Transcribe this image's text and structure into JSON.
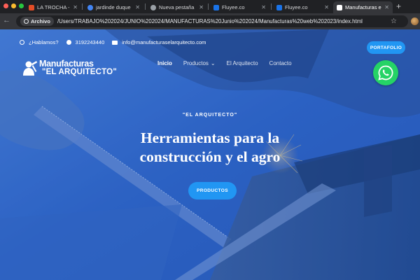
{
  "browser": {
    "tabs": [
      {
        "label": "LA TROCHA - La C",
        "favicon_color": "#e44d26",
        "active": false
      },
      {
        "label": "jardinde duque - Bu",
        "favicon_color": "#4285f4",
        "active": false
      },
      {
        "label": "Nueva pestaña",
        "favicon_color": "#9aa0a6",
        "active": false
      },
      {
        "label": "Fluyee.co",
        "favicon_color": "#1a73e8",
        "active": false
      },
      {
        "label": "Fluyee.co",
        "favicon_color": "#1a73e8",
        "active": false
      },
      {
        "label": "Manufacturas el ar",
        "favicon_color": "#ffffff",
        "active": true
      }
    ],
    "new_tab_label": "+",
    "back_label": "←",
    "forward_label": "→",
    "chip_label": "Archivo",
    "url": "/Users/TRABAJO%202024/JUNIO%202024/MANUFACTURAS%20Junio%202024/Manufacturas%20web%202023/index.html",
    "star_label": "☆"
  },
  "header": {
    "question_label": "¿Hablamos?",
    "phone": "3192243440",
    "email": "info@manufacturaselarquitecto.com",
    "logo_line1": "Manufacturas",
    "logo_line2": "\"EL ARQUITECTO\"",
    "nav": [
      {
        "label": "Inicio",
        "active": true
      },
      {
        "label": "Productos",
        "has_dropdown": true
      },
      {
        "label": "El Arquitecto"
      },
      {
        "label": "Contacto"
      }
    ],
    "dropdown_glyph": "⌄",
    "portfolio_label": "PORTAFOLIO"
  },
  "hero": {
    "kicker": "\"EL ARQUITECTO\"",
    "title_line1": "Herramientas para la",
    "title_line2": "construcción y el agro",
    "cta_label": "PRODUCTOS"
  },
  "colors": {
    "accent": "#2196f3",
    "whatsapp": "#25d366",
    "hero_overlay": "#2e5fbf"
  },
  "icons": {
    "whatsapp_float": "whatsapp-icon",
    "question": "question-icon",
    "phone": "whatsapp-small-icon",
    "email": "mail-icon"
  }
}
